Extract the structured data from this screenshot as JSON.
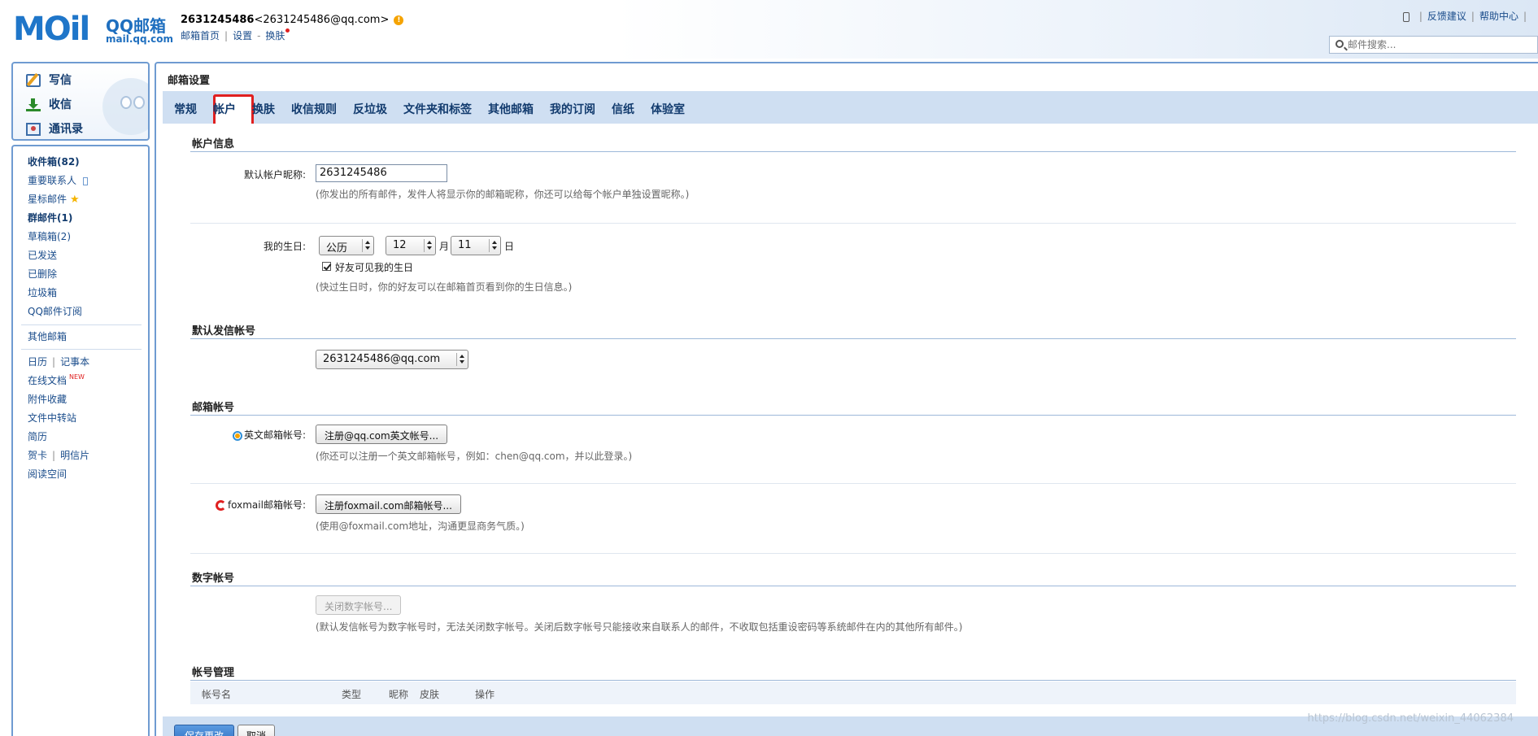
{
  "header": {
    "logo_text": "MOil",
    "logo_brand": "QQ邮箱",
    "logo_url": "mail.qq.com",
    "username": "2631245486",
    "email_display": "<2631245486@qq.com>",
    "links": {
      "home": "邮箱首页",
      "settings": "设置",
      "skin": "换肤"
    },
    "top_right": {
      "feedback": "反馈建议",
      "help": "帮助中心"
    },
    "search_placeholder": "邮件搜索..."
  },
  "sidebar": {
    "actions": {
      "write": "写信",
      "receive": "收信",
      "contacts": "通讯录"
    },
    "folders": {
      "inbox": "收件箱(82)",
      "important": "重要联系人",
      "starred": "星标邮件",
      "group": "群邮件(1)",
      "drafts": "草稿箱(2)",
      "sent": "已发送",
      "deleted": "已删除",
      "spam": "垃圾箱",
      "subscriptions": "QQ邮件订阅"
    },
    "other_mail": "其他邮箱",
    "tools": {
      "calendar": "日历",
      "notes": "记事本",
      "docs": "在线文档",
      "docs_badge": "NEW",
      "attachments": "附件收藏",
      "transfer": "文件中转站",
      "resume": "简历",
      "cards": "贺卡",
      "postcards": "明信片",
      "reading": "阅读空间"
    }
  },
  "main": {
    "title": "邮箱设置",
    "tabs": [
      "常规",
      "帐户",
      "换肤",
      "收信规则",
      "反垃圾",
      "文件夹和标签",
      "其他邮箱",
      "我的订阅",
      "信纸",
      "体验室"
    ],
    "account_info": {
      "section_title": "帐户信息",
      "nickname_label": "默认帐户昵称:",
      "nickname_value": "2631245486",
      "nickname_hint": "(你发出的所有邮件，发件人将显示你的邮箱昵称，你还可以给每个帐户单独设置昵称。)",
      "birthday_label": "我的生日:",
      "calendar_type": "公历",
      "month_value": "12",
      "month_unit": "月",
      "day_value": "11",
      "day_unit": "日",
      "friends_visible_label": "好友可见我的生日",
      "birthday_hint": "(快过生日时，你的好友可以在邮箱首页看到你的生日信息。)"
    },
    "default_sender": {
      "section_title": "默认发信帐号",
      "value": "2631245486@qq.com"
    },
    "mail_accounts": {
      "section_title": "邮箱帐号",
      "english_label": "英文邮箱帐号:",
      "english_button": "注册@qq.com英文帐号...",
      "english_hint": "(你还可以注册一个英文邮箱帐号，例如：chen@qq.com，并以此登录。)",
      "foxmail_label": "foxmail邮箱帐号:",
      "foxmail_button": "注册foxmail.com邮箱帐号...",
      "foxmail_hint": "(使用@foxmail.com地址，沟通更显商务气质。)"
    },
    "digit_account": {
      "section_title": "数字帐号",
      "button": "关闭数字帐号...",
      "hint": "(默认发信帐号为数字帐号时，无法关闭数字帐号。关闭后数字帐号只能接收来自联系人的邮件，不收取包括重设密码等系统邮件在内的其他所有邮件。)"
    },
    "account_management": {
      "section_title": "帐号管理",
      "columns": [
        "帐号名",
        "类型",
        "昵称",
        "皮肤",
        "操作"
      ]
    },
    "footer": {
      "save": "保存更改",
      "cancel": "取消"
    }
  },
  "watermark": "https://blog.csdn.net/weixin_44062384"
}
